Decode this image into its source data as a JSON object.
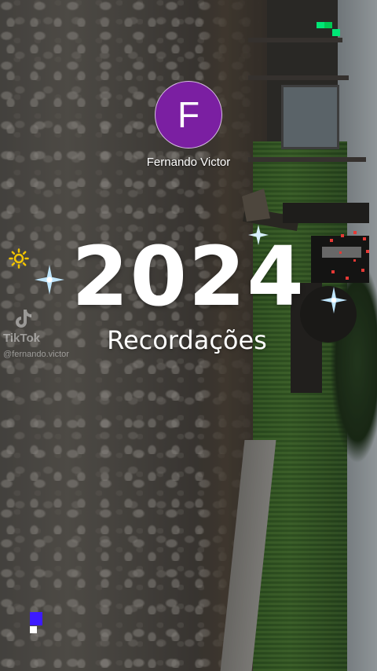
{
  "author": {
    "initial": "F",
    "name": "Fernando Victor"
  },
  "title": {
    "year": "2024",
    "subtitle": "Recordações"
  },
  "watermark": {
    "brand": "TikTok",
    "handle": "@fernando.victor"
  },
  "icons": {
    "sparkle": "four-point-star-icon",
    "sun": "sun-icon",
    "watermark_logo": "tiktok-logo-icon"
  },
  "colors": {
    "avatar_bg": "#7b1fa2",
    "sparkle": "#bfe6ff",
    "sun": "#f2c400",
    "dots": "#e53935",
    "pixel_green": "#00e676",
    "pixel_blue": "#3d1aff"
  }
}
